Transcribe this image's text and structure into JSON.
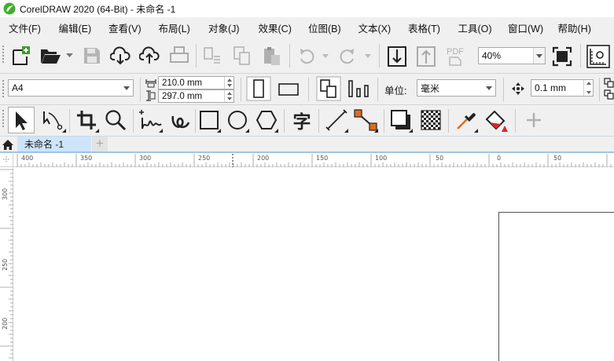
{
  "window": {
    "title": "CorelDRAW 2020 (64-Bit) - 未命名 -1"
  },
  "menu": [
    "文件(F)",
    "编辑(E)",
    "查看(V)",
    "布局(L)",
    "对象(J)",
    "效果(C)",
    "位图(B)",
    "文本(X)",
    "表格(T)",
    "工具(O)",
    "窗口(W)",
    "帮助(H)"
  ],
  "standard_toolbar": {
    "zoom": "40%",
    "pdf_label": "PDF"
  },
  "property_bar": {
    "page_size": "A4",
    "width": "210.0 mm",
    "height": "297.0 mm",
    "units_label": "单位:",
    "units_value": "毫米",
    "nudge": "0.1 mm"
  },
  "toolbox": {
    "text_tool_glyph": "字"
  },
  "tabs": {
    "document": "未命名 -1",
    "add": "+"
  },
  "rulers": {
    "horizontal": [
      "400",
      "350",
      "300",
      "250",
      "200",
      "150",
      "100",
      "50",
      "0",
      "50"
    ],
    "vertical": [
      "300",
      "250",
      "200"
    ]
  },
  "colors": {
    "chrome": "#f0f0f0",
    "tab_active": "#cde4fa",
    "tab_underline": "#9cc4ea",
    "accent_orange": "#e46a1c",
    "accent_red": "#d9262b",
    "icon": "#222222"
  }
}
